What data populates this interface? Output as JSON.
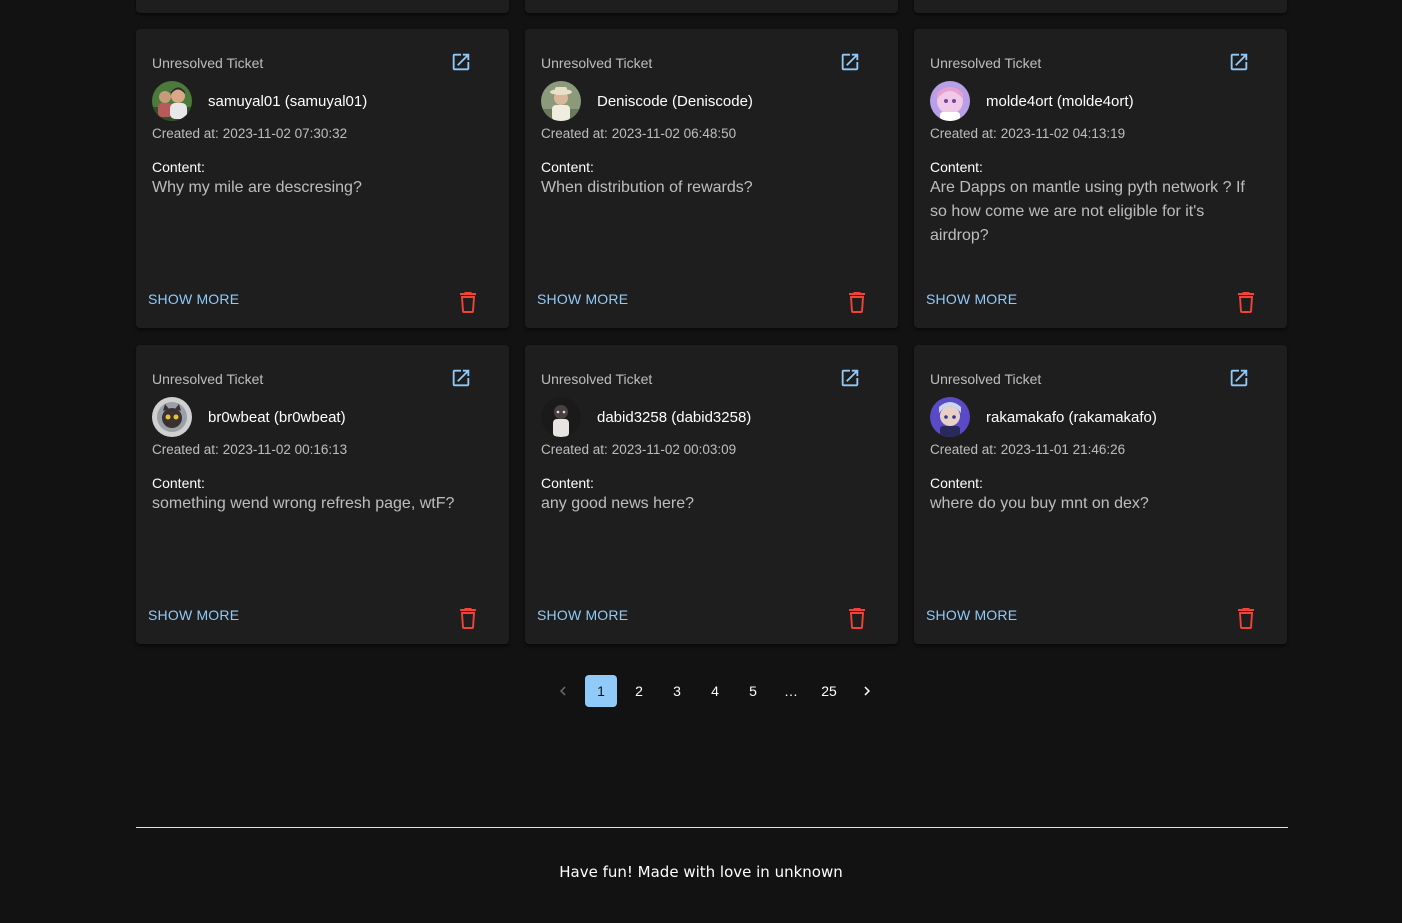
{
  "tickets": [
    {
      "type": "Unresolved Ticket",
      "user": "samuyal01 (samuyal01)",
      "created_label": "Created at:",
      "created_at": "2023-11-02 07:30:32",
      "content_label": "Content:",
      "content": "Why my mile are descresing?",
      "show_more": "SHOW MORE",
      "avatar": "photo-man-outdoor"
    },
    {
      "type": "Unresolved Ticket",
      "user": "Deniscode (Deniscode)",
      "created_label": "Created at:",
      "created_at": "2023-11-02 06:48:50",
      "content_label": "Content:",
      "content": "When distribution of rewards?",
      "show_more": "SHOW MORE",
      "avatar": "photo-person-hat"
    },
    {
      "type": "Unresolved Ticket",
      "user": "molde4ort (molde4ort)",
      "created_label": "Created at:",
      "created_at": "2023-11-02 04:13:19",
      "content_label": "Content:",
      "content": "Are Dapps on mantle using pyth network ? If so how come we are not eligible for it's airdrop?",
      "show_more": "SHOW MORE",
      "avatar": "anime-pink-hair"
    },
    {
      "type": "Unresolved Ticket",
      "user": "br0wbeat (br0wbeat)",
      "created_label": "Created at:",
      "created_at": "2023-11-02 00:16:13",
      "content_label": "Content:",
      "content": "something wend wrong refresh page, wtF?",
      "show_more": "SHOW MORE",
      "avatar": "cat-astronaut"
    },
    {
      "type": "Unresolved Ticket",
      "user": "dabid3258 (dabid3258)",
      "created_label": "Created at:",
      "created_at": "2023-11-02 00:03:09",
      "content_label": "Content:",
      "content": "any good news here?",
      "show_more": "SHOW MORE",
      "avatar": "dark-figure"
    },
    {
      "type": "Unresolved Ticket",
      "user": "rakamakafo (rakamakafo)",
      "created_label": "Created at:",
      "created_at": "2023-11-01 21:46:26",
      "content_label": "Content:",
      "content": "where do you buy mnt on dex?",
      "show_more": "SHOW MORE",
      "avatar": "anime-purple"
    }
  ],
  "pagination": {
    "prev_icon": "chevron-left-icon",
    "next_icon": "chevron-right-icon",
    "pages": [
      "1",
      "2",
      "3",
      "4",
      "5",
      "…",
      "25"
    ],
    "current": "1"
  },
  "footer": {
    "text": "Have fun! Made with love in unknown"
  },
  "colors": {
    "background": "#121212",
    "card": "#1e1e1e",
    "accent": "#90caf9",
    "delete": "#f44336"
  },
  "icons": {
    "open": "open-in-new-icon",
    "delete": "trash-icon"
  }
}
